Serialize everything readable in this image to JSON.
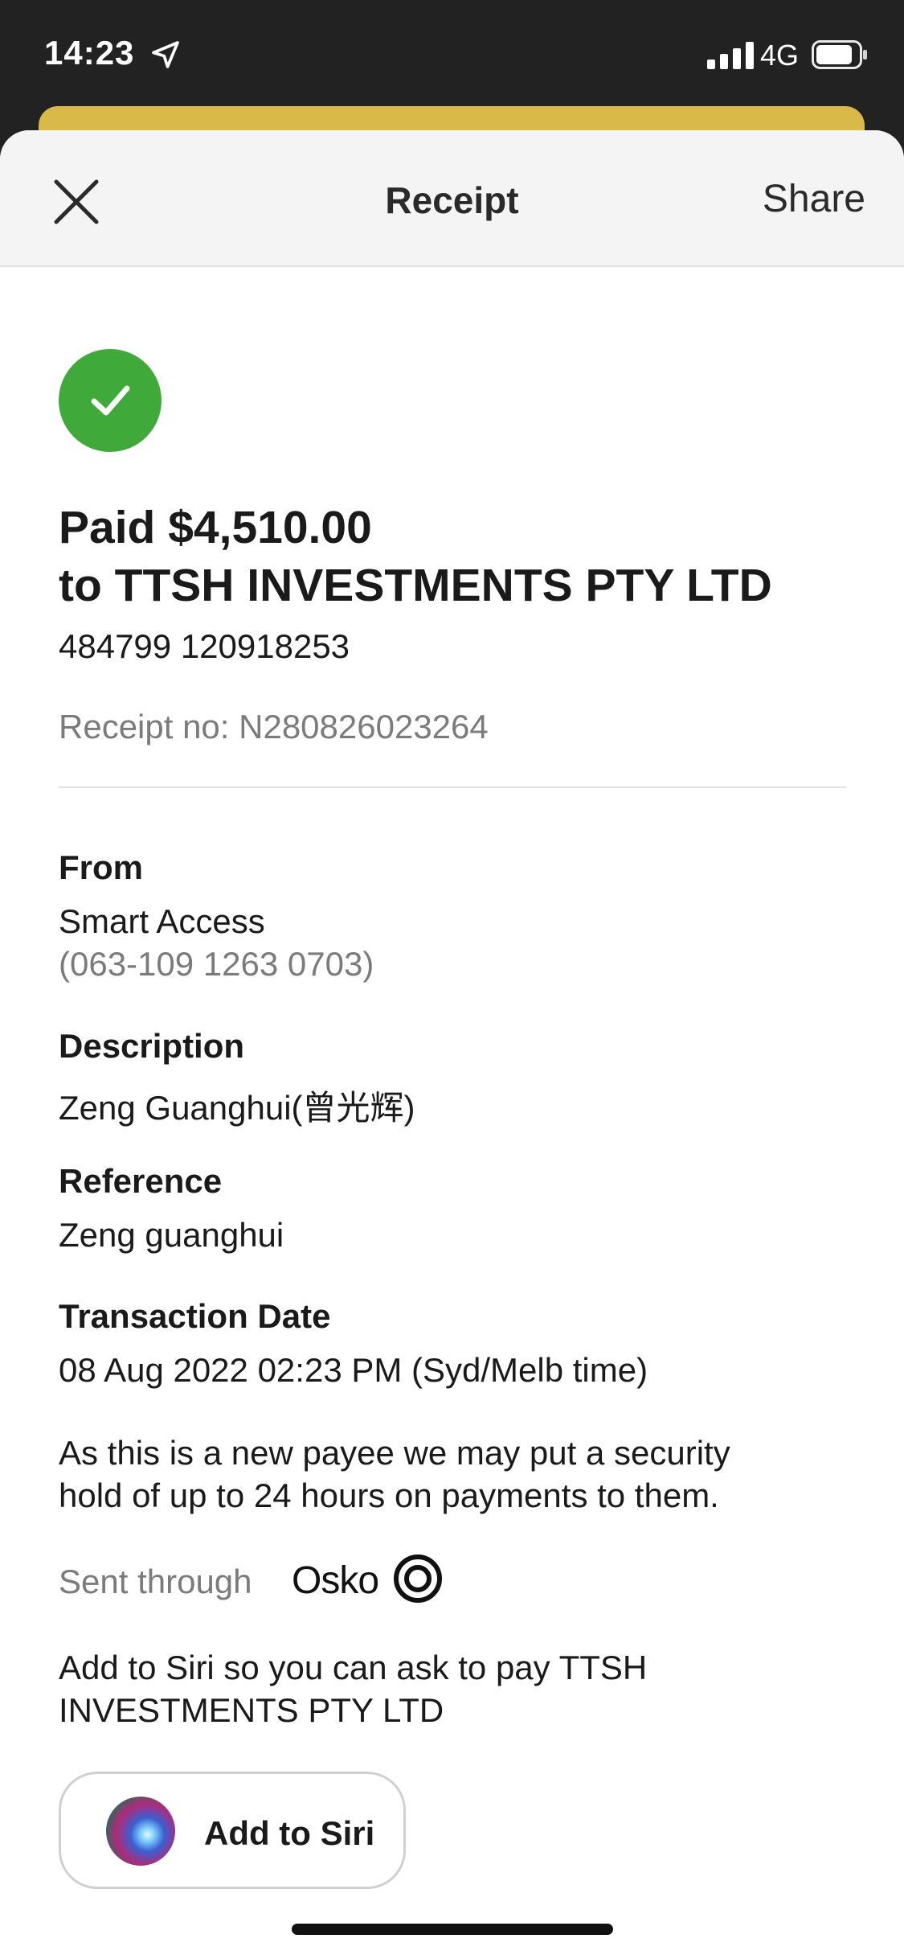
{
  "status_bar": {
    "time": "14:23",
    "network": "4G"
  },
  "nav": {
    "title": "Receipt",
    "share_label": "Share"
  },
  "payment": {
    "paid_line": "Paid $4,510.00",
    "payee_line": "to TTSH INVESTMENTS PTY LTD",
    "account_number": "484799 120918253",
    "receipt_no": "Receipt no: N280826023264"
  },
  "details": {
    "from_label": "From",
    "from_value": "Smart Access",
    "from_account": "(063-109 1263 0703)",
    "description_label": "Description",
    "description_value": "Zeng Guanghui(曾光辉)",
    "reference_label": "Reference",
    "reference_value": "Zeng guanghui",
    "date_label": "Transaction Date",
    "date_value": "08 Aug 2022 02:23 PM (Syd/Melb time)",
    "security_note_line1": "As this is a new payee we may put a security",
    "security_note_line2": "hold of up to 24 hours on payments to them.",
    "sent_through_label": "Sent through",
    "sent_through_service": "Osko",
    "siri_note_line1": "Add to Siri so you can ask to pay TTSH",
    "siri_note_line2": "INVESTMENTS PTY LTD"
  },
  "siri_button": {
    "label": "Add to Siri"
  },
  "colors": {
    "success_green": "#3fa93a",
    "accent_yellow": "#d9b94a",
    "muted_text": "#7b7b7b"
  },
  "icons": [
    "location-arrow-icon",
    "signal-icon",
    "battery-icon",
    "close-icon",
    "check-icon",
    "osko-icon",
    "siri-icon"
  ]
}
